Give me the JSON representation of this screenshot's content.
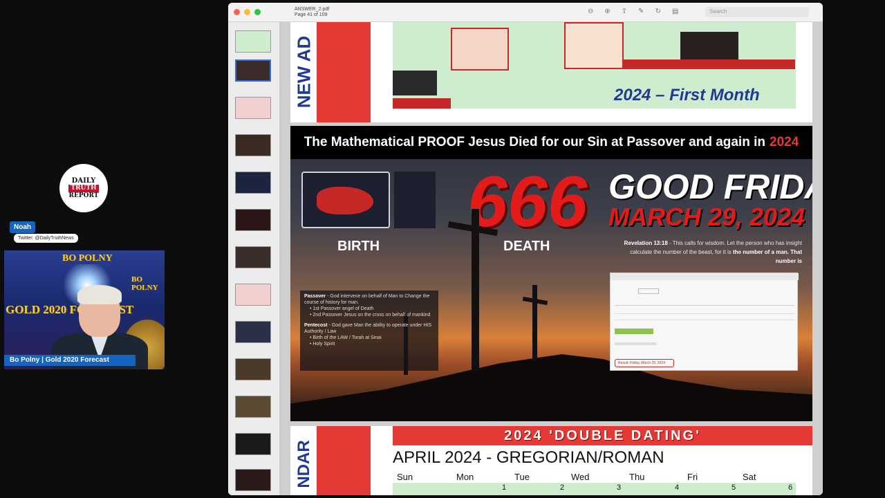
{
  "stream": {
    "logo": {
      "line1": "DAILY",
      "line2": "TRUTH",
      "line3": "REPORT"
    },
    "host_name": "Noah",
    "host_handle": "Twitter: @DailyTruthNews",
    "guest_caption": "Bo Polny | Gold 2020 Forecast",
    "webcam_backdrop": {
      "brand": "BO POLNY",
      "show": "GOLD 2020 FORECAST"
    }
  },
  "viewer": {
    "doc_title": "ANSWER_2.pdf",
    "doc_subtitle": "Page 41 of 109",
    "search_placeholder": "Search"
  },
  "page_top": {
    "vertical_text": "NEW AD",
    "heading": "2024 – First Month"
  },
  "slide": {
    "headline": "The Mathematical PROOF Jesus Died for our Sin at Passover and again in",
    "headline_year": "2024",
    "birth_label": "BIRTH",
    "number": "666",
    "death_label": "DEATH",
    "good_friday": "GOOD FRIDAY",
    "date": "MARCH 29, 2024",
    "revelation_ref": "Revelation 13:18",
    "revelation_text": "- This calls for wisdom. Let the person who has insight calculate the number of the beast, for it is",
    "revelation_bold": "the number of a man. That number is",
    "calc_result": "Result: Friday, March 29, 2024",
    "passover_title": "Passover",
    "passover_text": "- God intervene on behalf of Man to Change the course of history for man.",
    "passover_bullets": [
      "1st Passover angel of Death",
      "2nd Passover Jesus on the cross on behalf of mankind"
    ],
    "pentecost_title": "Pentecost",
    "pentecost_text": "- God gave Man the ability to operate under HIS Authority / Law",
    "pentecost_bullets": [
      "Birth of the LAW / Torah at Sinai",
      "Holy Spirit"
    ]
  },
  "page_bottom": {
    "vertical_text": "NDAR",
    "banner": "2024 'DOUBLE DATING'",
    "month_title": "APRIL 2024 - GREGORIAN/ROMAN",
    "weekdays": [
      "Sun",
      "Mon",
      "Tue",
      "Wed",
      "Thu",
      "Fri",
      "Sat"
    ],
    "first_dates": [
      "1",
      "2",
      "3",
      "4",
      "5",
      "6"
    ]
  },
  "colors": {
    "accent_red": "#e53935",
    "accent_blue": "#1f3a93",
    "calendar_green": "#cfeccf"
  }
}
